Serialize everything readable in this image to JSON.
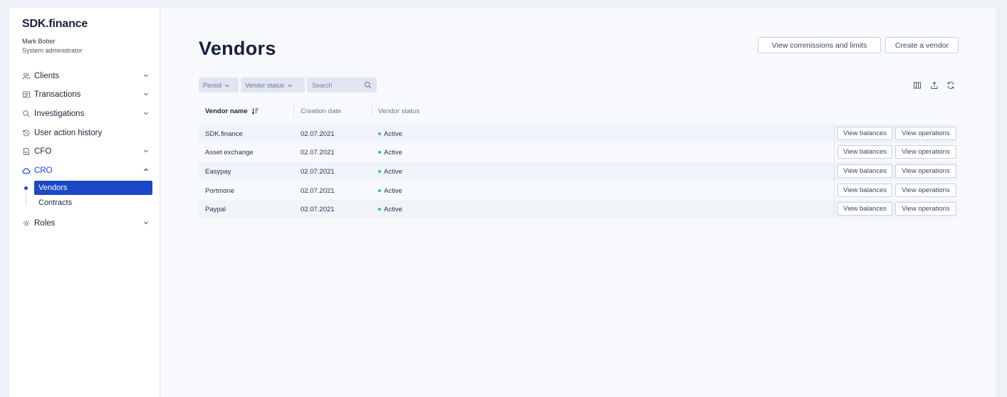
{
  "brand": "SDK.finance",
  "user": {
    "name": "Mark Bober",
    "role": "System administrator"
  },
  "nav": [
    {
      "label": "Clients",
      "icon": "users-icon",
      "expandable": true
    },
    {
      "label": "Transactions",
      "icon": "receipt-icon",
      "expandable": true
    },
    {
      "label": "Investigations",
      "icon": "magnifier-icon",
      "expandable": true
    },
    {
      "label": "User action history",
      "icon": "history-icon",
      "expandable": false
    },
    {
      "label": "CFO",
      "icon": "document-chart-icon",
      "expandable": true
    },
    {
      "label": "CRO",
      "icon": "cloud-icon",
      "expandable": true,
      "expanded": true
    },
    {
      "label": "Roles",
      "icon": "gear-icon",
      "expandable": true
    }
  ],
  "cro_sub": [
    {
      "label": "Vendors",
      "selected": true
    },
    {
      "label": "Contracts",
      "selected": false
    }
  ],
  "page": {
    "title": "Vendors",
    "btn_commissions": "View commissions and limits",
    "btn_create": "Create a vendor"
  },
  "filters": {
    "period": "Period",
    "vendor_status": "Vendor status",
    "search_placeholder": "Search"
  },
  "table": {
    "columns": [
      "Vendor name",
      "Creation date",
      "Vendor status"
    ],
    "rows": [
      {
        "name": "SDK.finance",
        "date": "02.07.2021",
        "status": "Active"
      },
      {
        "name": "Asset exchange",
        "date": "02.07.2021",
        "status": "Active"
      },
      {
        "name": "Easypay",
        "date": "02.07.2021",
        "status": "Active"
      },
      {
        "name": "Portmone",
        "date": "02.07.2021",
        "status": "Active"
      },
      {
        "name": "Paypal",
        "date": "02.07.2021",
        "status": "Active"
      }
    ],
    "action_balances": "View balances",
    "action_operations": "View operations"
  },
  "colors": {
    "accent": "#1d47c6",
    "active_status": "#2ec28f",
    "page_bg": "#eef2f8"
  }
}
